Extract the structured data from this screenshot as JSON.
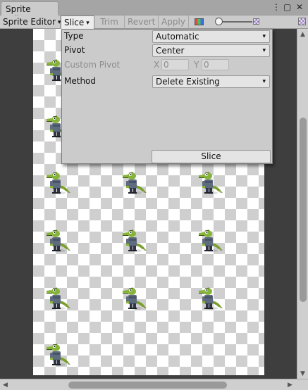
{
  "window": {
    "tab_title": "Sprite Editor",
    "kebab_icon": "kebab-menu-icon",
    "maximize_icon": "maximize-icon",
    "close_icon": "close-icon"
  },
  "toolbar": {
    "sprite_editor_label": "Sprite Editor",
    "slice_label": "Slice",
    "trim_label": "Trim",
    "revert_label": "Revert",
    "apply_label": "Apply",
    "caret": "▾",
    "color_channel_icon": "rgb-channel-icon",
    "zoom_level": 0.0,
    "small_icon": "checker-small-icon",
    "large_icon": "checker-large-icon"
  },
  "slice_popup": {
    "type_label": "Type",
    "type_value": "Automatic",
    "pivot_label": "Pivot",
    "pivot_value": "Center",
    "custom_pivot_label": "Custom Pivot",
    "x_label": "X",
    "x_value": "0",
    "y_label": "Y",
    "y_value": "0",
    "method_label": "Method",
    "method_value": "Delete Existing",
    "slice_button": "Slice",
    "dropdown_caret": "▾"
  },
  "canvas": {
    "sprite_icon": "crocodile-sprite-icon",
    "sprite_count": 16
  },
  "colors": {
    "window_bg": "#c2c2c2",
    "canvas_bg": "#3e3e3e",
    "checker_light": "#ffffff",
    "checker_dark": "#cfcfcf",
    "popup_bg": "#cbcbcb"
  }
}
